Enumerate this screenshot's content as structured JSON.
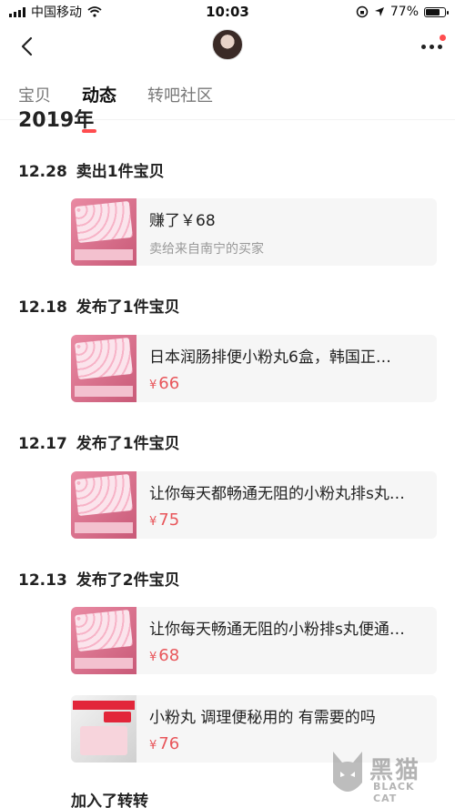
{
  "status_bar": {
    "carrier": "中国移动",
    "time": "10:03",
    "battery": "77%",
    "battery_level": 0.77
  },
  "nav": {
    "back_icon": "chevron-left-icon",
    "more_icon": "more-dots-icon"
  },
  "tabs": [
    {
      "label": "宝贝",
      "active": false
    },
    {
      "label": "动态",
      "active": true
    },
    {
      "label": "转吧社区",
      "active": false
    }
  ],
  "timeline": {
    "year": "2019年",
    "events": [
      {
        "date": "12.28",
        "action": "卖出1件宝贝",
        "items": [
          {
            "line1": "赚了￥68",
            "line2": "卖给来自南宁的买家"
          }
        ]
      },
      {
        "date": "12.18",
        "action": "发布了1件宝贝",
        "items": [
          {
            "title": "日本润肠排便小粉丸6盒，韩国正…",
            "currency": "¥",
            "price": "66"
          }
        ]
      },
      {
        "date": "12.17",
        "action": "发布了1件宝贝",
        "items": [
          {
            "title": "让你每天都畅通无阻的小粉丸排s丸…",
            "currency": "¥",
            "price": "75"
          }
        ]
      },
      {
        "date": "12.13",
        "action": "发布了2件宝贝",
        "items": [
          {
            "title": "让你每天畅通无阻的小粉排s丸便通…",
            "currency": "¥",
            "price": "68"
          },
          {
            "title": "小粉丸 调理便秘用的 有需要的吗",
            "currency": "¥",
            "price": "76"
          }
        ]
      }
    ],
    "footer_event": "加入了转转"
  },
  "watermark": {
    "text": "黑猫",
    "sub": "BLACK CAT"
  },
  "colors": {
    "accent": "#ff4d4f",
    "price": "#e8555a"
  }
}
